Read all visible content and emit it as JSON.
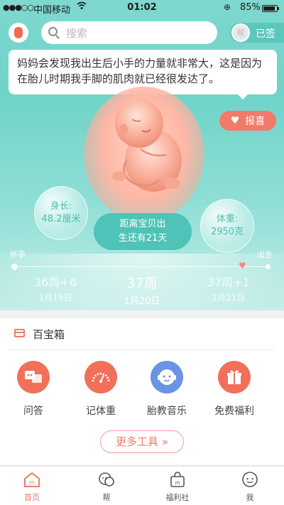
{
  "status_bar": {
    "carrier": "中国移动",
    "time": "01:02",
    "battery": "85%"
  },
  "header": {
    "search_placeholder": "搜索",
    "checkin_icon_text": "帮",
    "checkin_label": "已签"
  },
  "tip": {
    "text": "妈妈会发现我出生后小手的力量就非常大，这是因为在胎儿时期我手脚的肌肉就已经很发达了。"
  },
  "baobao_button": {
    "label": "报喜"
  },
  "stats": {
    "length_label": "身长:",
    "length_value": "48.2厘米",
    "weight_label": "体重:",
    "weight_value": "2950克"
  },
  "due": {
    "line1": "距离宝贝出",
    "line2": "生还有21天"
  },
  "timeline": {
    "start_label": "怀孕",
    "end_label": "出生",
    "weeks": [
      {
        "week": "36周+6",
        "date": "1月19日"
      },
      {
        "week": "37周",
        "date": "1月20日"
      },
      {
        "week": "37周+1",
        "date": "1月21日"
      }
    ]
  },
  "toolbox": {
    "title": "百宝箱",
    "tools": [
      {
        "label": "问答",
        "icon": "qa-icon",
        "color": "#f0705a"
      },
      {
        "label": "记体重",
        "icon": "scale-icon",
        "color": "#f0705a"
      },
      {
        "label": "胎教音乐",
        "icon": "music-baby-icon",
        "color": "#6b92e5"
      },
      {
        "label": "免费福利",
        "icon": "gift-icon",
        "color": "#f0705a"
      }
    ],
    "more_label": "更多工具 »"
  },
  "tabbar": {
    "tabs": [
      {
        "label": "首页",
        "icon": "home-icon"
      },
      {
        "label": "帮",
        "icon": "chat-icon"
      },
      {
        "label": "福利社",
        "icon": "bag-icon"
      },
      {
        "label": "我",
        "icon": "profile-icon"
      }
    ]
  },
  "colors": {
    "accent": "#f17a69",
    "teal": "#4fc3b7"
  }
}
